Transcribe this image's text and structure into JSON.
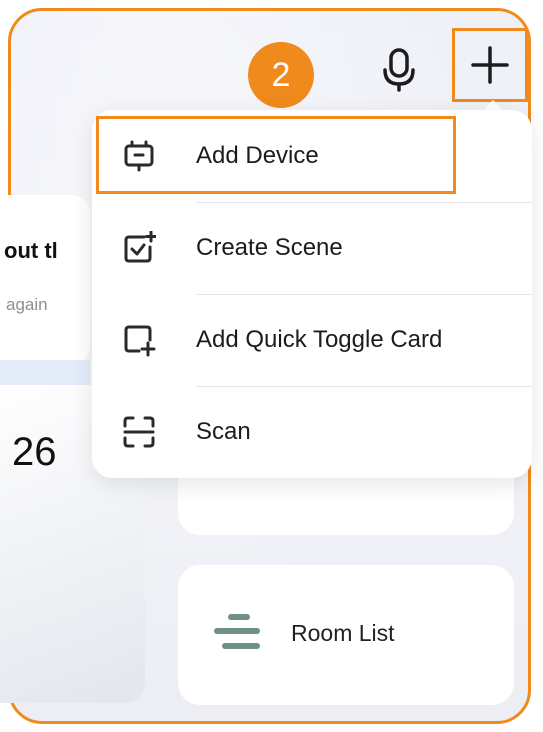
{
  "header": {
    "step_badge": "2",
    "mic_icon": "microphone-icon",
    "add_icon": "plus-icon"
  },
  "background": {
    "card_title_partial": "out tl",
    "card_subtitle_partial": "again",
    "number_partial": "26",
    "room_list_label": "Room List"
  },
  "menu": {
    "items": [
      {
        "label": "Add Device",
        "icon": "device-icon"
      },
      {
        "label": "Create Scene",
        "icon": "scene-icon"
      },
      {
        "label": "Add Quick Toggle Card",
        "icon": "add-card-icon"
      },
      {
        "label": "Scan",
        "icon": "scan-icon"
      }
    ]
  },
  "colors": {
    "accent": "#f08a1c",
    "icon_stroke": "#2a2a2e",
    "room_icon": "#6f9088"
  }
}
